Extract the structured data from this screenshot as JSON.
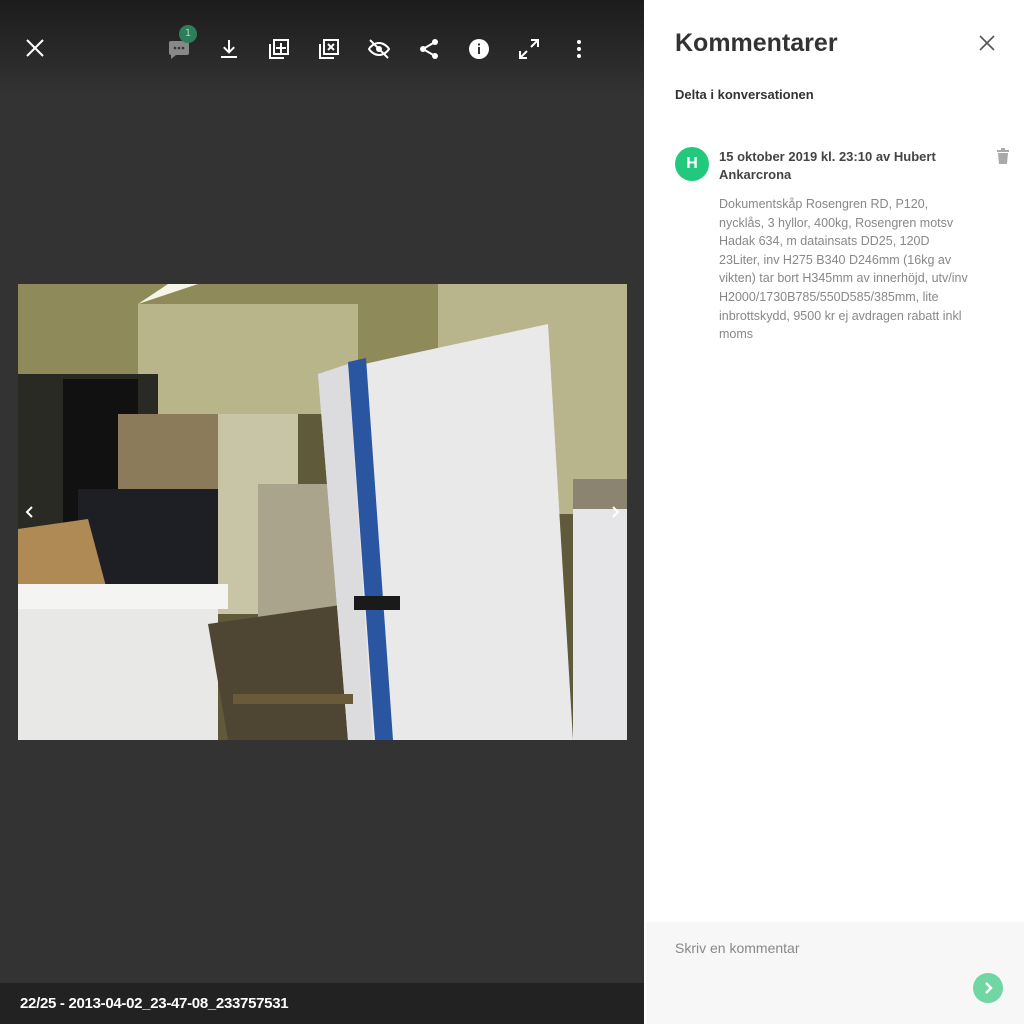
{
  "viewer": {
    "comment_count": "1",
    "footer_title": "22/25 - 2013-04-02_23-47-08_233757531",
    "toolbar": [
      "close-icon",
      "comment-icon",
      "download-icon",
      "add-to-album-icon",
      "remove-from-album-icon",
      "hide-icon",
      "share-icon",
      "info-icon",
      "fullscreen-icon",
      "more-icon"
    ]
  },
  "panel": {
    "title": "Kommentarer",
    "subtitle": "Delta i konversationen",
    "comments": [
      {
        "avatar_initial": "H",
        "meta": "15 oktober 2019 kl. 23:10 av Hubert Ankarcrona",
        "body": "Dokumentskåp Rosengren RD, P120, nycklås, 3 hyllor, 400kg, Rosengren motsv Hadak 634, m datainsats DD25, 120D 23Liter, inv H275 B340 D246mm (16kg av vikten) tar bort H345mm av innerhöjd, utv/inv H2000/1730B785/550D585/385mm, lite inbrottskydd, 9500 kr ej avdragen rabatt inkl moms"
      }
    ],
    "composer_placeholder": "Skriv en kommentar"
  },
  "colors": {
    "avatar": "#22c97c",
    "send": "#6fd6a4",
    "viewer_bg": "#333333"
  }
}
